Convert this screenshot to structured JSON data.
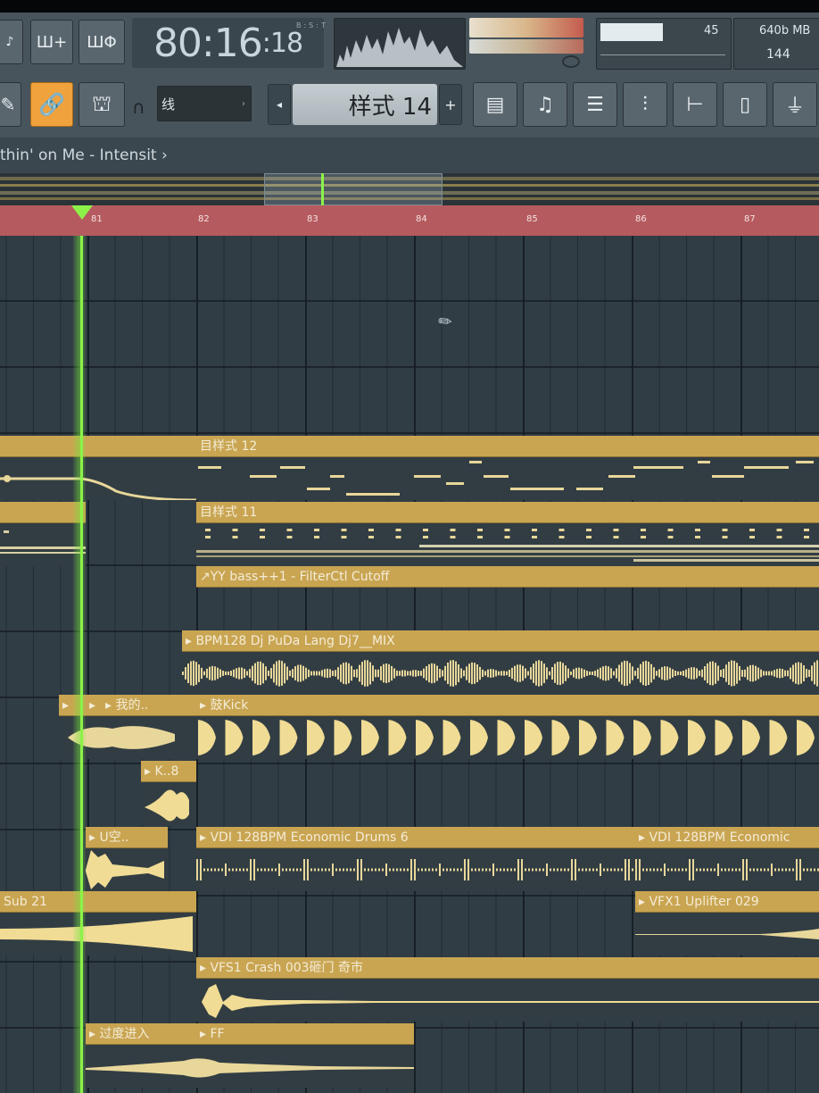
{
  "transport": {
    "time_main": "80:16",
    "time_small": "18",
    "time_unit": "B:S:T"
  },
  "toolbar": {
    "btn1": "Ш+",
    "btn2": "ШΦ",
    "snap_value": "线",
    "pattern_label": "样式 14",
    "pattern_minus": "◂",
    "pattern_plus": "+",
    "cpu_value": "45",
    "memory_value": "640b MB",
    "polyphony": "144"
  },
  "breadcrumb": "thin' on Me - Intensit ›",
  "ruler": {
    "bars": [
      "81",
      "82",
      "83",
      "84",
      "85",
      "86",
      "87"
    ]
  },
  "clips": [
    {
      "id": "pattern-12",
      "label": "目样式 12"
    },
    {
      "id": "pattern-11",
      "label": "目样式 11"
    },
    {
      "id": "automation",
      "label": "↗YY bass++1 - FilterCtl Cutoff"
    },
    {
      "id": "bpm128",
      "label": "▸ BPM128 Dj PuDa Lang Dj7__MIX"
    },
    {
      "id": "wode",
      "label": "▸ 我的.."
    },
    {
      "id": "kick",
      "label": "▸ 鼓Kick"
    },
    {
      "id": "k8",
      "label": "▸ K..8"
    },
    {
      "id": "uang",
      "label": "▸ U空.."
    },
    {
      "id": "vdi-1",
      "label": "▸ VDI 128BPM Economic Drums 6"
    },
    {
      "id": "vdi-2",
      "label": "▸ VDI 128BPM Economic"
    },
    {
      "id": "sub21",
      "label": "Sub 21"
    },
    {
      "id": "uplifter",
      "label": "▸ VFX1 Uplifter 029"
    },
    {
      "id": "crash",
      "label": "▸ VFS1 Crash 003砸门 奇市"
    },
    {
      "id": "transition",
      "label": "▸ 过度进入"
    },
    {
      "id": "ff",
      "label": "▸ FF"
    }
  ],
  "colors": {
    "clip": "#c9a552",
    "ruler": "#b55a5e",
    "playhead": "#8cf24a",
    "grid": "#313d45"
  }
}
